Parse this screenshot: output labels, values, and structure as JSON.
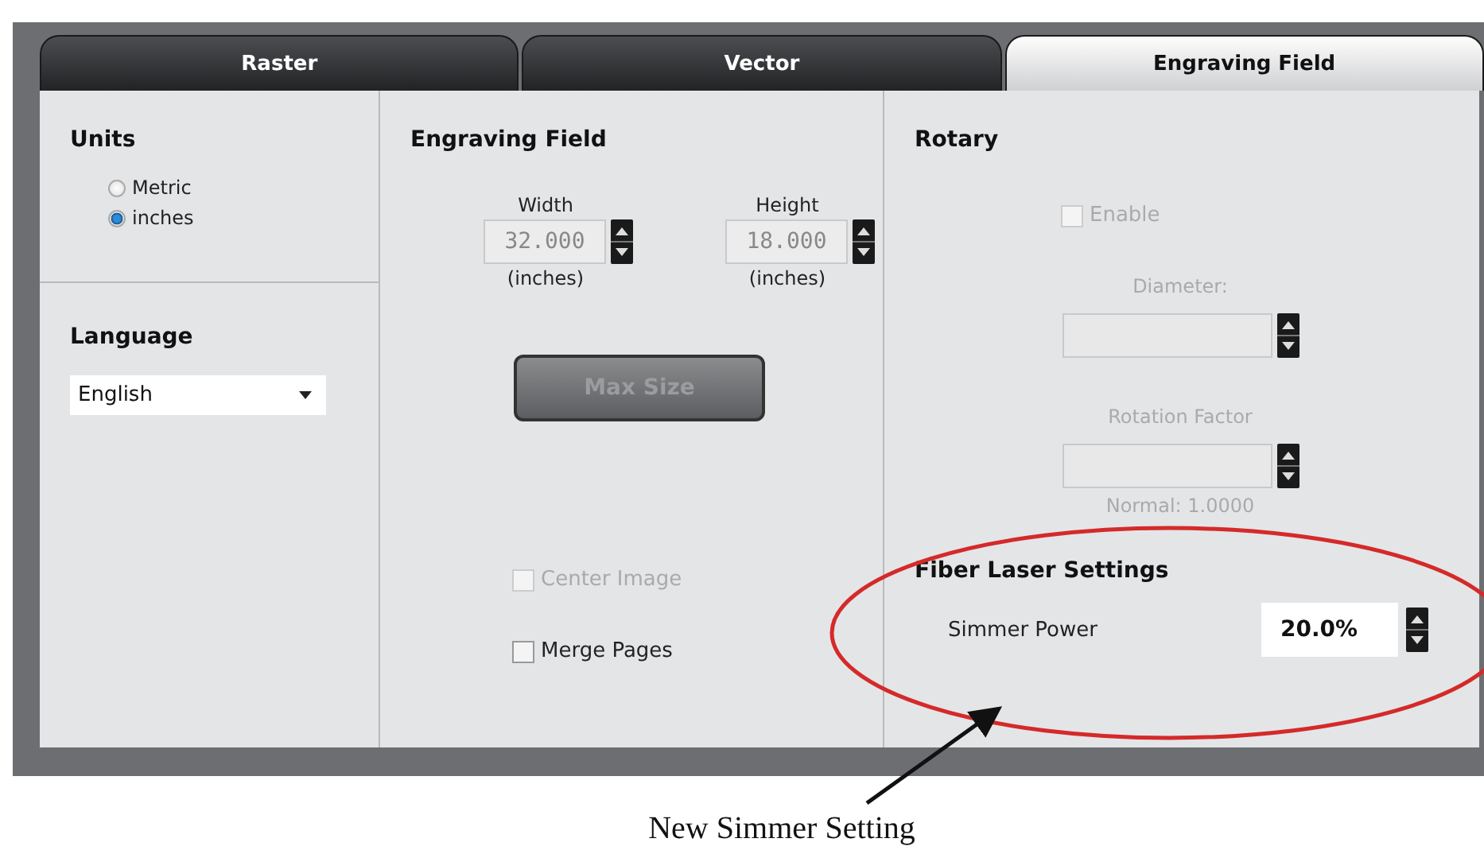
{
  "tabs": [
    {
      "label": "Raster",
      "selected": false
    },
    {
      "label": "Vector",
      "selected": false
    },
    {
      "label": "Engraving Field",
      "selected": true
    }
  ],
  "units": {
    "title": "Units",
    "options": [
      {
        "label": "Metric",
        "selected": false
      },
      {
        "label": "inches",
        "selected": true
      }
    ]
  },
  "language": {
    "title": "Language",
    "value": "English"
  },
  "engraving_field": {
    "title": "Engraving Field",
    "fields": [
      {
        "label": "Width",
        "value": "32.000",
        "unit": "(inches)"
      },
      {
        "label": "Height",
        "value": "18.000",
        "unit": "(inches)"
      }
    ],
    "max_size_button": {
      "label": "Max Size",
      "disabled": true
    },
    "checkboxes": [
      {
        "label": "Center Image",
        "checked": false,
        "disabled": true
      },
      {
        "label": "Merge Pages",
        "checked": false,
        "disabled": false
      }
    ]
  },
  "rotary": {
    "title": "Rotary",
    "enable": {
      "label": "Enable",
      "checked": false,
      "disabled": true
    },
    "fields": [
      {
        "label": "Diameter:"
      },
      {
        "label": "Rotation Factor",
        "hint": "Normal: 1.0000"
      }
    ]
  },
  "fiber_laser": {
    "title": "Fiber Laser Settings",
    "simmer_power": {
      "label": "Simmer Power",
      "value": "20.0%"
    }
  },
  "annotation": {
    "text": "New Simmer Setting"
  }
}
